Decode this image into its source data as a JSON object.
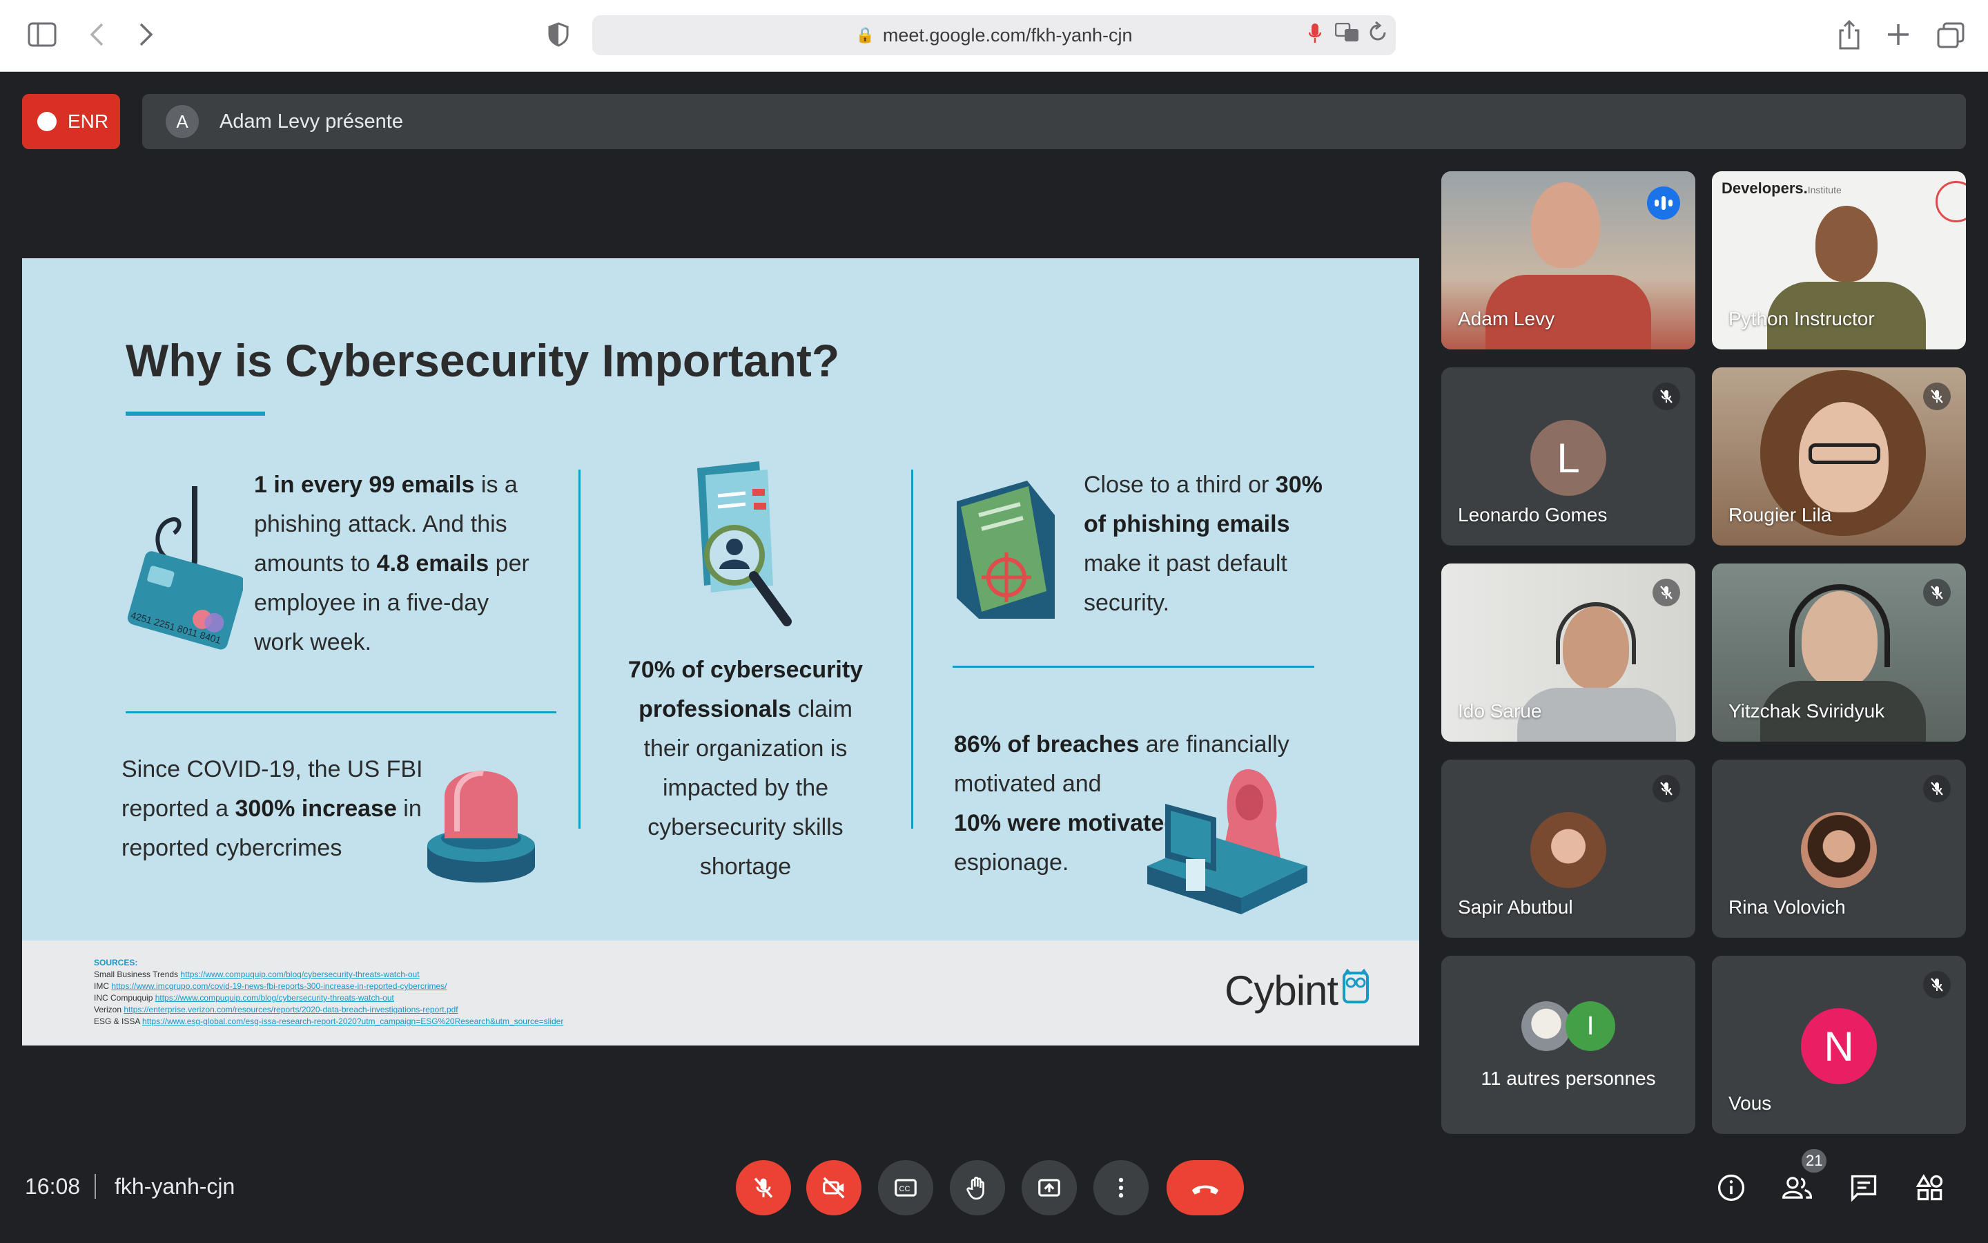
{
  "browser": {
    "url": "meet.google.com/fkh-yanh-cjn",
    "icons": [
      "sidebar-icon",
      "back-icon",
      "forward-icon",
      "shield-icon",
      "share-icon",
      "new-tab-icon",
      "tabs-overview-icon"
    ]
  },
  "topbar": {
    "record_label": "ENR",
    "presenter_initial": "A",
    "presenter_text": "Adam Levy présente"
  },
  "slide": {
    "title": "Why is Cybersecurity Important?",
    "stat1": {
      "b1": "1 in every 99 emails",
      "t1": " is a phishing attack. And this amounts to ",
      "b2": "4.8 emails",
      "t2": " per employee in a five-day work week."
    },
    "stat2": {
      "t1": "Since COVID-19, the US FBI reported a ",
      "b1": "300% increase",
      "t2": " in reported cybercrimes"
    },
    "stat3": {
      "b1": "70% of cybersecurity professionals",
      "t1": " claim their organization is impacted by the cybersecurity skills shortage"
    },
    "stat4": {
      "t1": "Close to a third or ",
      "b1": "30% of phishing emails",
      "t2": " make it past default security."
    },
    "stat5": {
      "b1": "86% of breaches",
      "t1": " are financially motivated and ",
      "b2": "10% were motivated",
      "t2": " by espionage."
    },
    "card_number": "4251 2251 8011 8401",
    "sources_heading": "SOURCES:",
    "sources": [
      {
        "label": "Small Business Trends",
        "url": "https://www.compuquip.com/blog/cybersecurity-threats-watch-out"
      },
      {
        "label": "IMC",
        "url": "https://www.imcgrupo.com/covid-19-news-fbi-reports-300-increase-in-reported-cybercrimes/"
      },
      {
        "label": "INC Compuquip",
        "url": "https://www.compuquip.com/blog/cybersecurity-threats-watch-out"
      },
      {
        "label": "Verizon",
        "url": "https://enterprise.verizon.com/resources/reports/2020-data-breach-investigations-report.pdf"
      },
      {
        "label": "ESG & ISSA",
        "url": "https://www.esg-global.com/esg-issa-research-report-2020?utm_campaign=ESG%20Research&utm_source=slider"
      }
    ],
    "logo_text": "Cybint"
  },
  "participants": [
    {
      "name": "Adam Levy",
      "speaking": true
    },
    {
      "name": "Python Instructor",
      "overlay": "Developers.",
      "overlay_small": "Institute"
    },
    {
      "name": "Leonardo Gomes",
      "initial": "L",
      "color": "#8d6e63"
    },
    {
      "name": "Rougier Lila"
    },
    {
      "name": "Ido Sarue"
    },
    {
      "name": "Yitzchak Sviridyuk"
    },
    {
      "name": "Sapir Abutbul"
    },
    {
      "name": "Rina Volovich"
    },
    {
      "name": "11 autres personnes",
      "initial": "I",
      "color": "#43a047"
    },
    {
      "name": "Vous",
      "initial": "N",
      "color": "#e91e63"
    }
  ],
  "bottombar": {
    "time": "16:08",
    "meeting_code": "fkh-yanh-cjn",
    "participant_count": "21"
  },
  "colors": {
    "accent": "#1a98c6",
    "danger": "#ea4335",
    "meet_bg": "#202124",
    "tile_bg": "#3c4043"
  }
}
